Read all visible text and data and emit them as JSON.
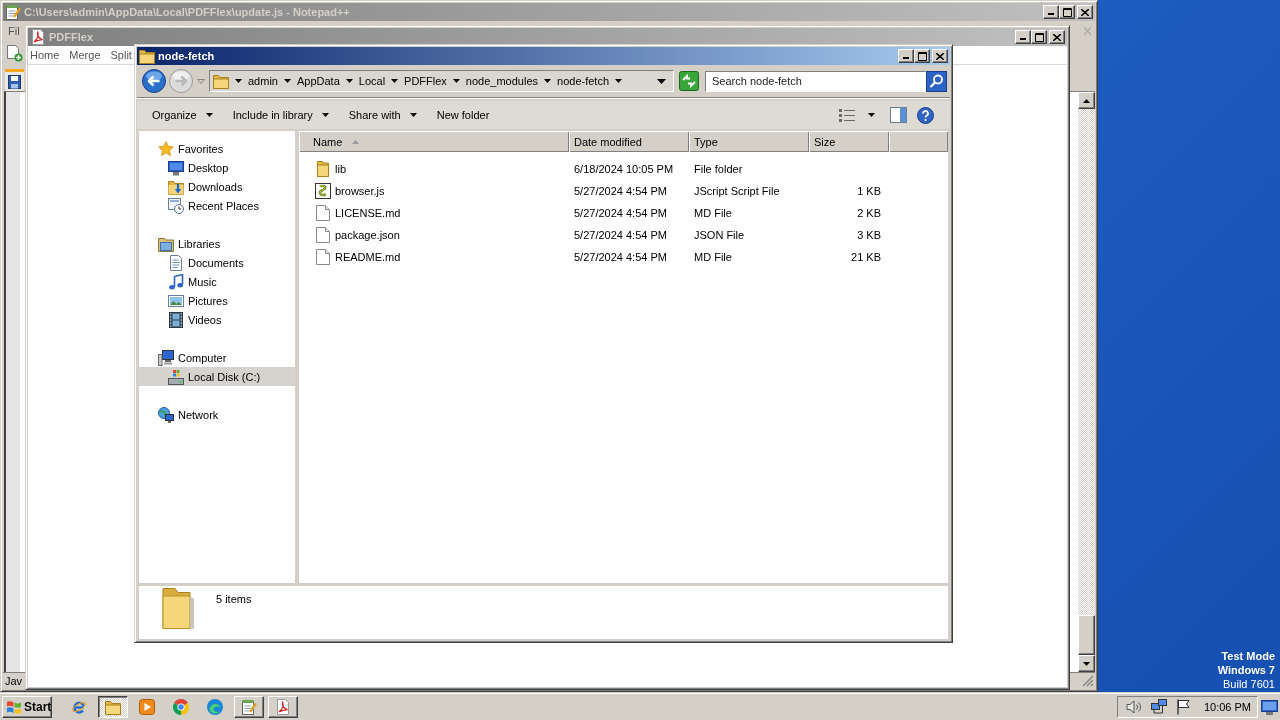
{
  "desktop": {
    "lines": [
      "Test Mode",
      "Windows 7",
      "Build 7601"
    ]
  },
  "notepad_window": {
    "title": "C:\\Users\\admin\\AppData\\Local\\PDFFlex\\update.js - Notepad++",
    "active": false,
    "menu": [
      "Fil"
    ],
    "status_bar": "Jav"
  },
  "pdfflex_window": {
    "title": "PDFFlex",
    "active": false,
    "menu": [
      "Home",
      "Merge",
      "Split"
    ]
  },
  "explorer_window": {
    "title": "node-fetch",
    "active": true,
    "breadcrumb": [
      "admin",
      "AppData",
      "Local",
      "PDFFlex",
      "node_modules",
      "node-fetch"
    ],
    "search": {
      "placeholder": "Search node-fetch"
    },
    "toolbar": [
      {
        "label": "Organize",
        "dropdown": true
      },
      {
        "label": "Include in library",
        "dropdown": true
      },
      {
        "label": "Share with",
        "dropdown": true
      },
      {
        "label": "New folder",
        "dropdown": false
      }
    ],
    "navigation": [
      {
        "label": "Favorites",
        "kind": "favorites",
        "selected": false,
        "children": [
          {
            "label": "Desktop",
            "kind": "desktop",
            "selected": false
          },
          {
            "label": "Downloads",
            "kind": "downloads",
            "selected": false
          },
          {
            "label": "Recent Places",
            "kind": "recent",
            "selected": false
          }
        ]
      },
      {
        "label": "Libraries",
        "kind": "libraries",
        "selected": false,
        "children": [
          {
            "label": "Documents",
            "kind": "documents",
            "selected": false
          },
          {
            "label": "Music",
            "kind": "music",
            "selected": false
          },
          {
            "label": "Pictures",
            "kind": "pictures",
            "selected": false
          },
          {
            "label": "Videos",
            "kind": "videos",
            "selected": false
          }
        ]
      },
      {
        "label": "Computer",
        "kind": "computer",
        "selected": false,
        "children": [
          {
            "label": "Local Disk (C:)",
            "kind": "disk",
            "selected": true
          }
        ]
      },
      {
        "label": "Network",
        "kind": "network",
        "selected": false
      }
    ],
    "columns": [
      {
        "label": "Name",
        "sorted": true
      },
      {
        "label": "Date modified",
        "sorted": false
      },
      {
        "label": "Type",
        "sorted": false
      },
      {
        "label": "Size",
        "sorted": false
      }
    ],
    "files": [
      {
        "name": "lib",
        "date_modified": "6/18/2024 10:05 PM",
        "type": "File folder",
        "kind": "folder",
        "selected": false
      },
      {
        "name": "browser.js",
        "date_modified": "5/27/2024 4:54 PM",
        "type": "JScript Script File",
        "size": "1 KB",
        "kind": "script",
        "selected": false
      },
      {
        "name": "LICENSE.md",
        "date_modified": "5/27/2024 4:54 PM",
        "type": "MD File",
        "size": "2 KB",
        "kind": "file",
        "selected": false
      },
      {
        "name": "package.json",
        "date_modified": "5/27/2024 4:54 PM",
        "type": "JSON File",
        "size": "3 KB",
        "kind": "file",
        "selected": false
      },
      {
        "name": "README.md",
        "date_modified": "5/27/2024 4:54 PM",
        "type": "MD File",
        "size": "21 KB",
        "kind": "file",
        "selected": false
      }
    ],
    "details": {
      "item_count": "5 items"
    }
  },
  "taskbar": {
    "start": "Start",
    "apps": [
      {
        "kind": "ie",
        "running": false,
        "selected": false
      },
      {
        "kind": "explorer",
        "running": true,
        "selected": true
      },
      {
        "kind": "media",
        "running": false,
        "selected": false
      },
      {
        "kind": "chrome",
        "running": false,
        "selected": false
      },
      {
        "kind": "edge",
        "running": false,
        "selected": false
      },
      {
        "kind": "notepad",
        "running": true,
        "selected": false
      },
      {
        "kind": "pdf",
        "running": true,
        "selected": false
      }
    ],
    "clock": "10:06 PM"
  }
}
